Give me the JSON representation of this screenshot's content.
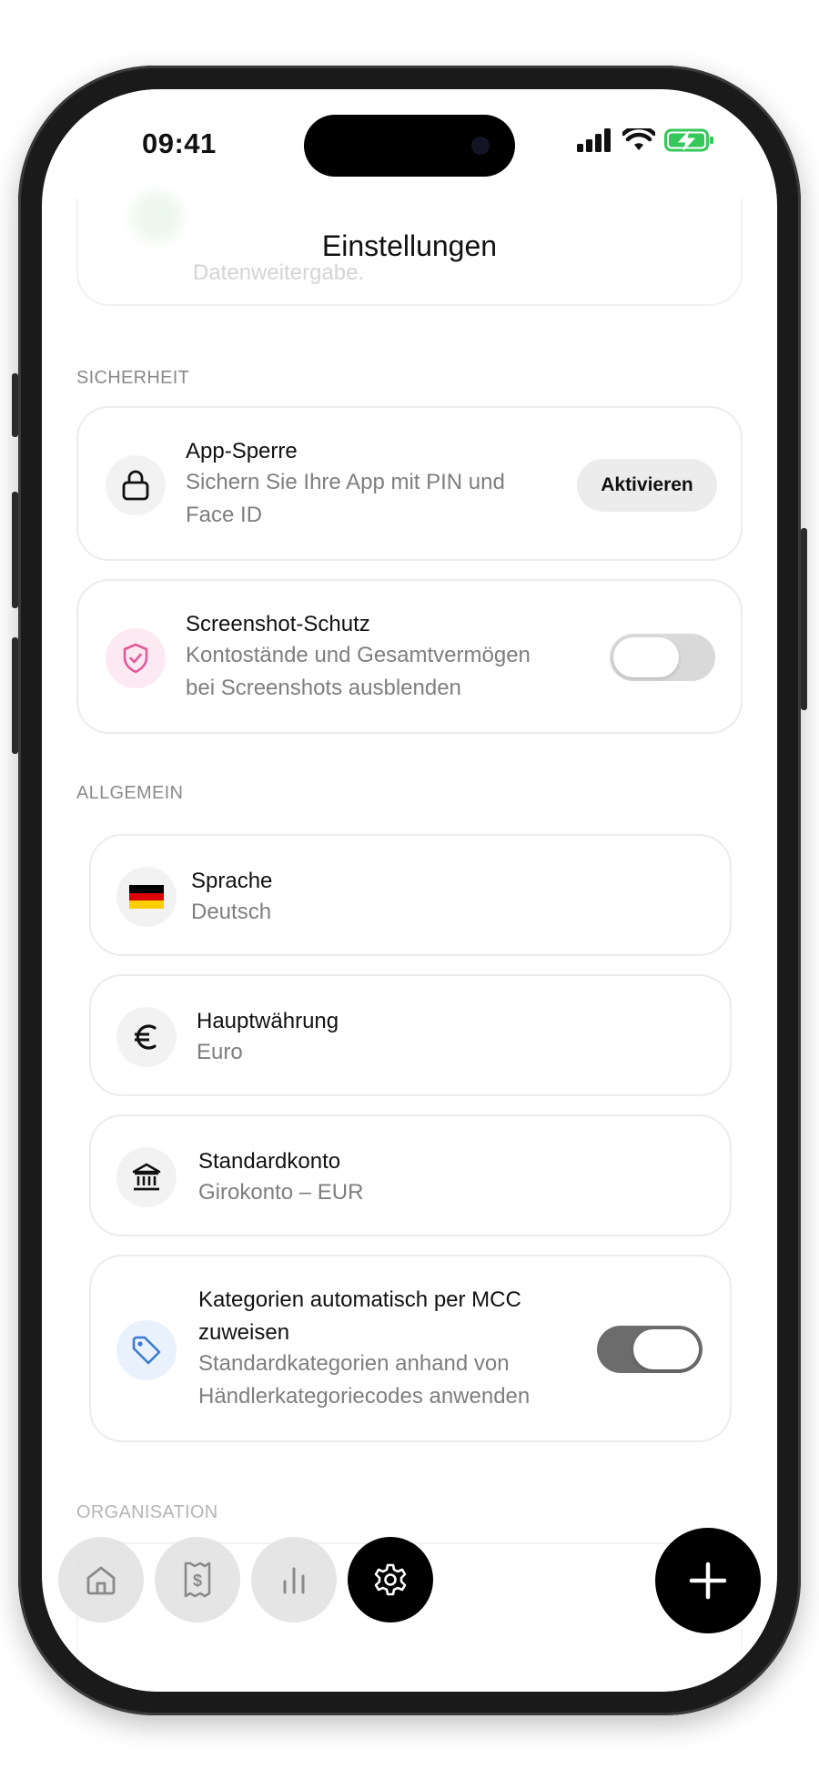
{
  "status_bar": {
    "time": "09:41"
  },
  "header": {
    "title": "Einstellungen"
  },
  "faded_top": {
    "text": "Datenweitergabe."
  },
  "sections": {
    "security": {
      "label": "SICHERHEIT",
      "app_lock": {
        "title": "App-Sperre",
        "subtitle_line1": "Sichern Sie Ihre App mit PIN und",
        "subtitle_line2": "Face ID",
        "button_label": "Aktivieren",
        "icon": "lock-icon"
      },
      "screenshot_protection": {
        "title": "Screenshot-Schutz",
        "subtitle_line1": "Kontostände und Gesamtvermögen",
        "subtitle_line2": "bei Screenshots ausblenden",
        "icon": "shield-check-icon",
        "enabled": false
      }
    },
    "general": {
      "label": "ALLGEMEIN",
      "language": {
        "title": "Sprache",
        "value": "Deutsch",
        "icon": "german-flag-icon"
      },
      "currency": {
        "title": "Hauptwährung",
        "value": "Euro",
        "icon": "euro-icon"
      },
      "default_account": {
        "title": "Standardkonto",
        "value": "Girokonto – EUR",
        "icon": "bank-icon"
      },
      "mcc": {
        "title_line1": "Kategorien automatisch per MCC",
        "title_line2": "zuweisen",
        "subtitle_line1": "Standardkategorien anhand von",
        "subtitle_line2": "Händlerkategoriecodes anwenden",
        "icon": "tag-icon",
        "enabled": true
      }
    },
    "organisation": {
      "label": "ORGANISATION"
    }
  },
  "tab_bar": {
    "tabs": [
      {
        "name": "home",
        "icon": "home-icon",
        "active": false
      },
      {
        "name": "receipts",
        "icon": "receipt-icon",
        "active": false
      },
      {
        "name": "statistics",
        "icon": "bar-chart-icon",
        "active": false
      },
      {
        "name": "settings",
        "icon": "gear-icon",
        "active": true
      }
    ],
    "fab_icon": "plus-icon"
  },
  "colors": {
    "accent": "#000000",
    "shield_pink": "#e05a9a",
    "tag_blue": "#3a7bd5",
    "flag_black": "#000000",
    "flag_red": "#dd0000",
    "flag_gold": "#ffce00"
  }
}
